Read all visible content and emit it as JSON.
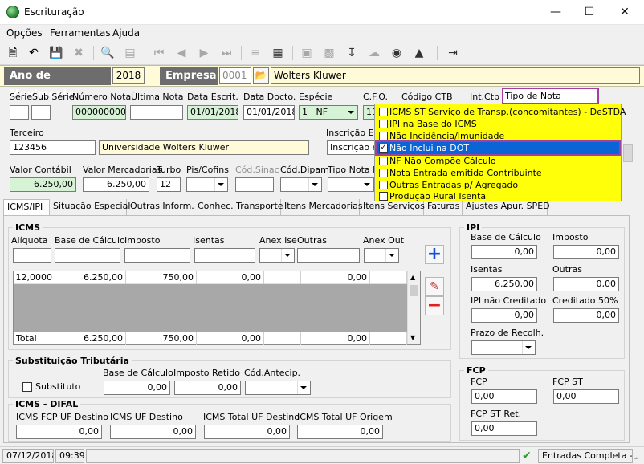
{
  "window": {
    "title": "Escrituração"
  },
  "menu": [
    "Opções",
    "Ferramentas",
    "Ajuda"
  ],
  "header": {
    "ano_label": "Ano de Movimento",
    "ano": "2018",
    "empresa_label": "Empresa",
    "empresa_codigo": "0001",
    "empresa_nome": "Wolters Kluwer"
  },
  "row1": {
    "serie_lbl": "Série",
    "subserie_lbl": "Sub Série",
    "numero_lbl": "Número Nota",
    "numero": "0000000002",
    "ultima_lbl": "Última Nota",
    "data_escrit_lbl": "Data Escrit.",
    "data_escrit": "01/01/2018",
    "data_docto_lbl": "Data Docto.",
    "data_docto": "01/01/2018",
    "especie_lbl": "Espécie",
    "especie_cod": "1",
    "especie": "NF",
    "cfo_lbl": "C.F.O.",
    "cfo": "11",
    "codigo_ctb_lbl": "Código CTB",
    "int_ctb_lbl": "Int.Ctb",
    "tipo_nota_lbl": "Tipo de Nota Associada"
  },
  "row2": {
    "terceiro_lbl": "Terceiro",
    "terceiro_cod": "123456",
    "terceiro_nome": "Universidade Wolters Kluwer",
    "inscricao_lbl": "Inscrição Est",
    "inscricao": "Inscrição e"
  },
  "row3": {
    "valor_contabil_lbl": "Valor Contábil",
    "valor_contabil": "6.250,00",
    "valor_merc_lbl": "Valor Mercadorias",
    "valor_merc": "6.250,00",
    "turbo_lbl": "Turbo",
    "turbo": "12",
    "pis_lbl": "Pis/Cofins",
    "sinac_lbl": "Cód.Sinac",
    "dipam_lbl": "Cód.Dipam",
    "tipo_nota_is_lbl": "Tipo Nota IS"
  },
  "dropdown": {
    "items": [
      {
        "label": "ICMS ST Serviço de Transp.(concomitantes) - DeSTDA",
        "checked": false
      },
      {
        "label": "IPI na Base do ICMS",
        "checked": false
      },
      {
        "label": "Não Incidência/Imunidade",
        "checked": false
      },
      {
        "label": "Não Inclui na DOT",
        "checked": true
      },
      {
        "label": "NF Não Compõe Cálculo",
        "checked": false
      },
      {
        "label": "Nota Entrada emitida Contribuinte",
        "checked": false
      },
      {
        "label": "Outras Entradas p/ Agregado",
        "checked": false
      },
      {
        "label": "Produção Rural Isenta",
        "checked": false
      }
    ]
  },
  "tabs": [
    "ICMS/IPI",
    "Situação Especial",
    "Outras Inform.",
    "Conhec. Transporte",
    "Itens Mercadorias",
    "Itens Serviços",
    "Faturas",
    "Ajustes Apur. SPED"
  ],
  "icms": {
    "title": "ICMS",
    "aliquota": "Alíquota",
    "base": "Base de Cálculo",
    "imposto": "Imposto",
    "isentas": "Isentas",
    "anex_ise": "Anex Ise",
    "outras": "Outras",
    "anex_out": "Anex Out",
    "row": [
      "12,0000",
      "6.250,00",
      "750,00",
      "0,00",
      "0,00"
    ],
    "total_lbl": "Total",
    "total": [
      "6.250,00",
      "750,00",
      "0,00",
      "0,00"
    ]
  },
  "st": {
    "title": "Substituição Tributária",
    "substituto": "Substituto",
    "base_lbl": "Base de Cálculo",
    "base": "0,00",
    "retido_lbl": "Imposto Retido",
    "retido": "0,00",
    "antecip_lbl": "Cód.Antecip."
  },
  "difal": {
    "title": "ICMS - DIFAL",
    "fcp_lbl": "ICMS FCP UF Destino",
    "fcp": "0,00",
    "uf_dest_lbl": "ICMS UF Destino",
    "uf_dest": "0,00",
    "total_dest_lbl": "ICMS Total UF Destino",
    "total_dest": "0,00",
    "total_orig_lbl": "ICMS Total UF Origem",
    "total_orig": "0,00"
  },
  "ipi": {
    "title": "IPI",
    "base_lbl": "Base de Cálculo",
    "base": "0,00",
    "imposto_lbl": "Imposto",
    "imposto": "0,00",
    "isentas_lbl": "Isentas",
    "isentas": "6.250,00",
    "outras_lbl": "Outras",
    "outras": "0,00",
    "nao_cred_lbl": "IPI não Creditado",
    "nao_cred": "0,00",
    "cred50_lbl": "Creditado 50%",
    "cred50": "0,00",
    "prazo_lbl": "Prazo de Recolh."
  },
  "fcp": {
    "title": "FCP",
    "fcp_lbl": "FCP",
    "fcp": "0,00",
    "fcpst_lbl": "FCP ST",
    "fcpst": "0,00",
    "fcpret_lbl": "FCP ST Ret.",
    "fcpret": "0,00"
  },
  "status": {
    "date": "07/12/2018",
    "time": "09:39",
    "mode": "Entradas Completa - P"
  }
}
